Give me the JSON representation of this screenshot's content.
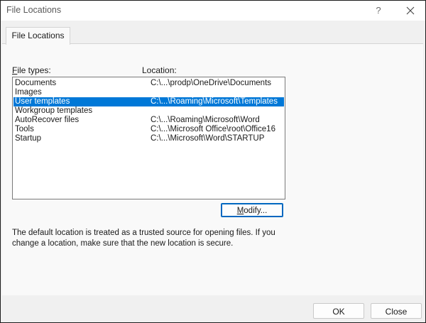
{
  "window": {
    "title": "File Locations",
    "help_label": "?"
  },
  "tabs": [
    {
      "label": "File Locations"
    }
  ],
  "headers": {
    "file_types": "File types:",
    "location": "Location:"
  },
  "file_types": [
    {
      "type": "Documents",
      "location": "C:\\...\\prodp\\OneDrive\\Documents",
      "selected": false
    },
    {
      "type": "Images",
      "location": "",
      "selected": false
    },
    {
      "type": "User templates",
      "location": "C:\\...\\Roaming\\Microsoft\\Templates",
      "selected": true
    },
    {
      "type": "Workgroup templates",
      "location": "",
      "selected": false
    },
    {
      "type": "AutoRecover files",
      "location": "C:\\...\\Roaming\\Microsoft\\Word",
      "selected": false
    },
    {
      "type": "Tools",
      "location": "C:\\...\\Microsoft Office\\root\\Office16",
      "selected": false
    },
    {
      "type": "Startup",
      "location": "C:\\...\\Microsoft\\Word\\STARTUP",
      "selected": false
    }
  ],
  "buttons": {
    "modify": "Modify...",
    "ok": "OK",
    "close": "Close"
  },
  "note": "The default location is treated as a trusted source for opening files. If you change a location, make sure that the new location is secure.",
  "colors": {
    "selection": "#0078d7",
    "focus_border": "#0067c0"
  }
}
